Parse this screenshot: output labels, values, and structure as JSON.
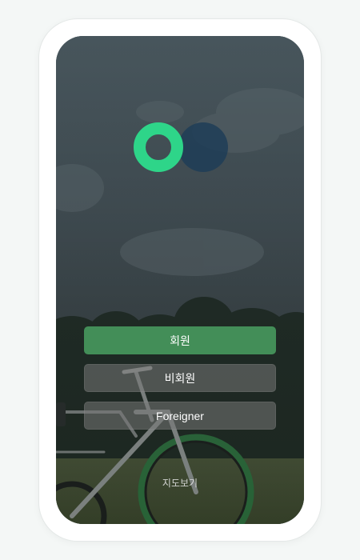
{
  "buttons": {
    "member_label": "회원",
    "guest_label": "비회원",
    "foreigner_label": "Foreigner"
  },
  "map_link": {
    "label": "지도보기"
  },
  "colors": {
    "brand_green": "#2ed589",
    "brand_navy": "#1f3d57",
    "member_button": "#4aa062",
    "bike_tire_green": "#3ea85a"
  }
}
